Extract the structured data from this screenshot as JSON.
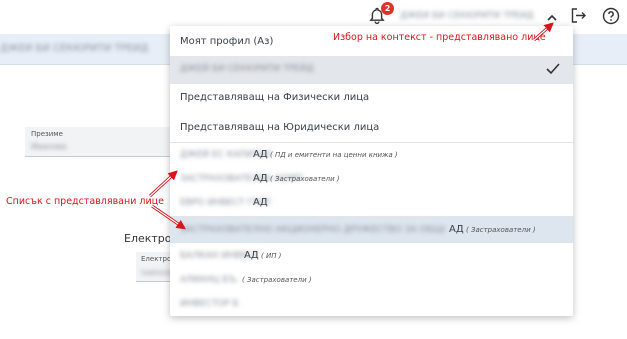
{
  "header": {
    "notification_count": "2",
    "context_name": "ДЖЕЙ БИ СЕКЮРИТИ ТРЕЙД"
  },
  "banner": {
    "title": "ДЖЕЙ БИ СЕКЮРИТИ ТРЕЙД"
  },
  "form": {
    "field1_label": "Презиме",
    "field1_value": "Иванова",
    "section_heading": "Електро",
    "field2_label": "Електрон",
    "field2_value": "ivanova"
  },
  "dropdown": {
    "my_profile": "Моят профил (Аз)",
    "selected_context": "ДЖЕЙ БИ СЕКЮРИТИ ТРЕЙД",
    "represent_individuals": "Представляващ на Физически лица",
    "represent_legal": "Представляващ на Юридически лица",
    "entities": [
      {
        "name": "ДЖЕЙ ЕС КАПИТАЛ",
        "suffix": "АД",
        "category": "( ПД и емитенти на ценни книжа )"
      },
      {
        "name": "ЗАСТРАХОВАТЕЛНА КОМП",
        "suffix": "АД",
        "category": "( Застрахователи )"
      },
      {
        "name": "ЕВРО ИНВЕСТ ГРУП",
        "suffix": "АД",
        "category": ""
      },
      {
        "name": "ЗАСТРАХОВАТЕЛНО АКЦИОНЕРНО ДРУЖЕСТВО ЗА ОБЩО ЗАСТРАХОВАНЕ",
        "suffix": "АД",
        "category": "( Застрахователи )"
      },
      {
        "name": "БАЛКАН ИНВЕСТ",
        "suffix": "АД",
        "category": "( ИП )"
      },
      {
        "name": "АЛИАНЦ БЪЛГАРИЯ",
        "suffix": "",
        "category": "( Застрахователи )"
      },
      {
        "name": "ИНВЕСТОР БГ",
        "suffix": "",
        "category": ""
      }
    ]
  },
  "annotations": {
    "context_selection": "Избор на контекст - представлявано лице",
    "represented_list": "Списък с представлявани лице"
  },
  "colors": {
    "annotation": "#d9141c",
    "badge": "#d9342b",
    "highlight_row": "#dde5ee",
    "selected_row": "#e3e6ea"
  }
}
